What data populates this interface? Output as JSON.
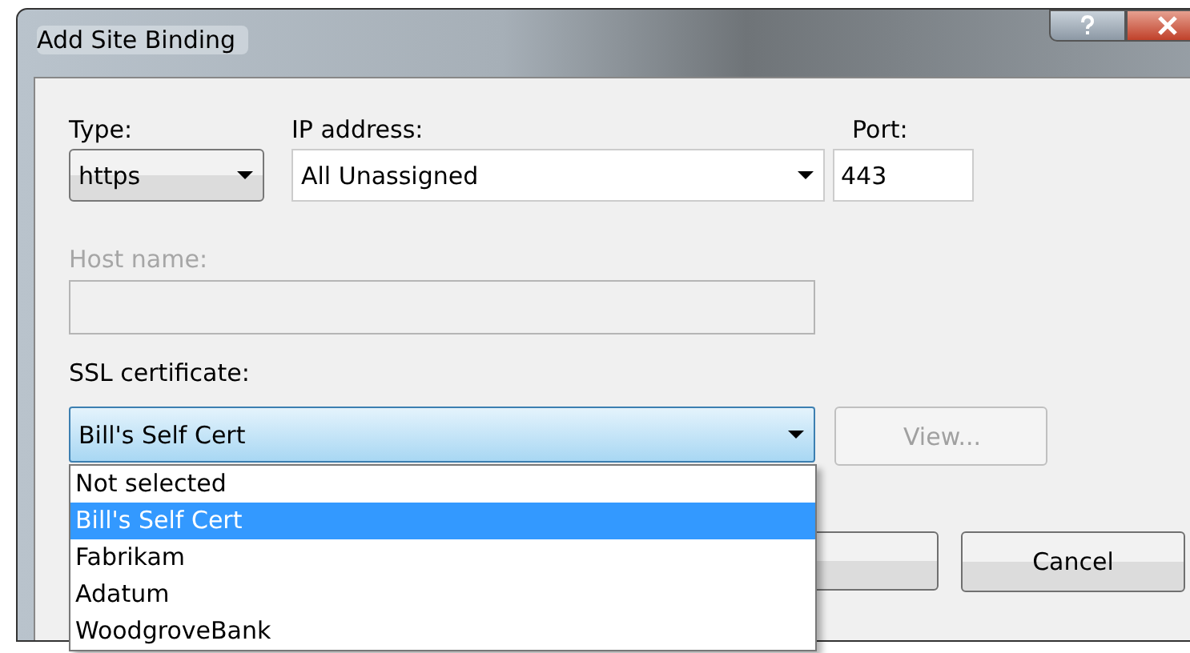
{
  "window": {
    "title": "Add Site Binding"
  },
  "type": {
    "label": "Type:",
    "value": "https"
  },
  "ip_address": {
    "label": "IP address:",
    "value": "All Unassigned"
  },
  "port": {
    "label": "Port:",
    "value": "443"
  },
  "host_name": {
    "label": "Host name:",
    "disabled": true
  },
  "ssl_certificate": {
    "label": "SSL certificate:",
    "value": "Bill's Self Cert",
    "expanded": true,
    "options": [
      {
        "label": "Not selected",
        "selected": false
      },
      {
        "label": "Bill's Self Cert",
        "selected": true
      },
      {
        "label": "Fabrikam",
        "selected": false
      },
      {
        "label": "Adatum",
        "selected": false
      },
      {
        "label": "WoodgroveBank",
        "selected": false
      }
    ]
  },
  "view_button": {
    "label": "View...",
    "disabled": true
  },
  "cancel_button": {
    "label": "Cancel"
  }
}
